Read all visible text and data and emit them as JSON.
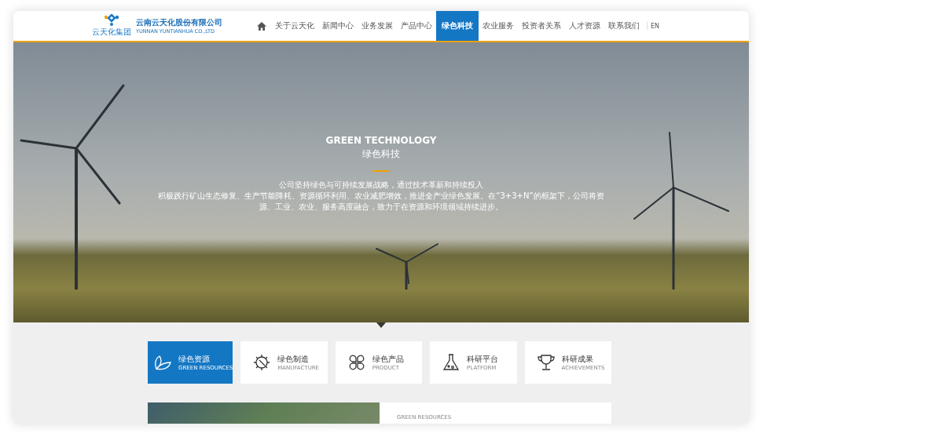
{
  "logo": {
    "name": "云南云天化股份有限公司",
    "name_en": "YUNNAN YUNTIANHUA CO.,LTD",
    "badge": "云天化集团"
  },
  "nav": [
    {
      "label": "关于云天化",
      "selected": false
    },
    {
      "label": "新闻中心",
      "selected": false
    },
    {
      "label": "业务发展",
      "selected": false
    },
    {
      "label": "产品中心",
      "selected": false
    },
    {
      "label": "绿色科技",
      "selected": true
    },
    {
      "label": "农业服务",
      "selected": false
    },
    {
      "label": "投资者关系",
      "selected": false
    },
    {
      "label": "人才资源",
      "selected": false
    },
    {
      "label": "联系我们",
      "selected": false
    }
  ],
  "lang": "EN",
  "hero": {
    "title_en": "GREEN TECHNOLOGY",
    "title": "绿色科技",
    "lines": [
      "公司坚持绿色与可持续发展战略，通过技术革新和持续投入",
      "积极践行矿山生态修复、生产节能降耗、资源循环利用、农业减肥增效，推进全产业绿色发展。在“3+3+N”的框架下，公司将资",
      "源、工业、农业、服务高度融合，致力于在资源和环境领域持续进步。"
    ]
  },
  "categories": [
    {
      "kind": "leaf",
      "title": "绿色资源",
      "subtitle": "GREEN RESOURCES",
      "selected": true
    },
    {
      "kind": "gear",
      "title": "绿色制造",
      "subtitle": "MANUFACTURE",
      "selected": false
    },
    {
      "kind": "clover",
      "title": "绿色产品",
      "subtitle": "PRODUCT",
      "selected": false
    },
    {
      "kind": "flask",
      "title": "科研平台",
      "subtitle": "PLATFORM",
      "selected": false
    },
    {
      "kind": "trophy",
      "title": "科研成果",
      "subtitle": "ACHIEVEMENTS",
      "selected": false
    }
  ],
  "section": {
    "label": "GREEN RESOURCES"
  }
}
